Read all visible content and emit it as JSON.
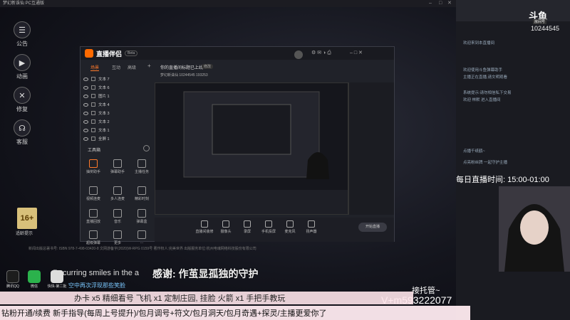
{
  "colors": {
    "accent": "#ff7a2b",
    "blue_text": "#7bc8ff",
    "douyu_orange": "#ff6a00"
  },
  "game_window": {
    "title": "梦幻新诛仙 PC互通版",
    "sidebar": [
      {
        "label": "公告",
        "icon": "announcement-icon"
      },
      {
        "label": "动画",
        "icon": "video-icon"
      },
      {
        "label": "修复",
        "icon": "wrench-icon"
      },
      {
        "label": "客服",
        "icon": "headset-icon"
      }
    ],
    "age_badge": "16+",
    "age_label": "适龄提示",
    "footer_note": "新闻出版总署书号: ISBN 978-7-498-03420-8 文网游备字(2020)W-RPG 0159号 著作权人:完美世界 出版服务单位:杭州电魂网络科技股份有限公司"
  },
  "stream_window": {
    "logo": "直播伴侣",
    "version": "Beta",
    "tabs": [
      "场景",
      "互动",
      "高级"
    ],
    "active_tab": 0,
    "scenes": [
      "文本 7",
      "文本 6",
      "图片 1",
      "文本 4",
      "文本 3",
      "文本 2",
      "文本 1",
      "全屏 1"
    ],
    "toolbox_title": "工具箱",
    "tools": [
      "抽奖助手",
      "弹幕助手",
      "主播任务",
      "视频连麦",
      "多人连麦",
      "精彩时刻",
      "直播回放",
      "音乐",
      "弹幕盒",
      "超级弹幕",
      "更多",
      "..."
    ],
    "room_title": "你的直播间标题已上线~",
    "room_chip": "修改",
    "room_meta": "梦幻新诛仙   10244545   193253",
    "bottom_tools": [
      "直播间装修",
      "摄像头",
      "录屏",
      "手机投屏",
      "麦克风",
      "扬声器"
    ],
    "stop_label": "开始直播"
  },
  "chat_panel": {
    "brand": "斗鱼",
    "brand_sub": "房间号",
    "room_id": "10244545",
    "lines": [
      "欢迎来到本直播间",
      "欢迎使用斗鱼弹幕助手",
      "主播正在直播,请文明观看",
      "系统提示:请勿相信私下交易",
      "欢迎 林默 进入直播间",
      "点播千纸鹤~",
      "点亮粉丝牌 一起守护主播"
    ],
    "daily_time": "每日直播时间: 15:00-01:00"
  },
  "overlay": {
    "marquee": "Recurring smiles in the a",
    "thanks": "感谢: 作茧显孤独的守护",
    "tip_blue": "空中再次浮现那些笑脸",
    "hosting": "接托管~",
    "wechat": "V+m593222077",
    "gift_line1": "办卡 x5 精细看号   飞机 x1 定制庄园, 挂脸   火箭 x1 手把手教玩",
    "gift_line2": "钻粉开通/续费 新手指导(每周上号提升)/包月调号+符文/包月洞天/包月奇遇+探灵/主播更爱你了",
    "dock": [
      {
        "label": "腾讯QQ",
        "icon": "qq-icon"
      },
      {
        "label": "微信",
        "icon": "wechat-icon"
      },
      {
        "label": "快快-第二批",
        "icon": "folder-icon"
      }
    ]
  }
}
